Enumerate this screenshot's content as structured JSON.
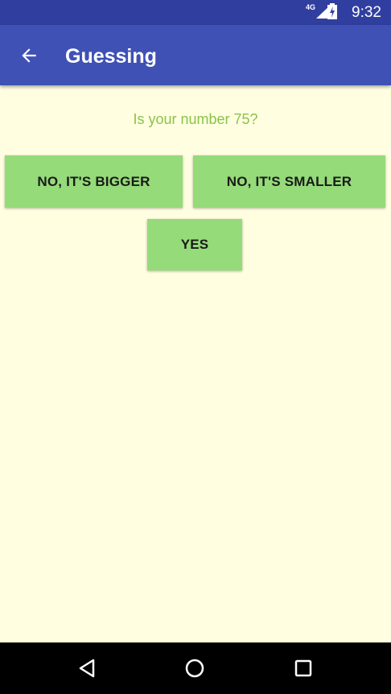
{
  "status_bar": {
    "network": "4G",
    "time": "9:32",
    "icons": [
      "signal-icon",
      "battery-charging-icon"
    ]
  },
  "app_bar": {
    "title": "Guessing",
    "back_icon": "arrow-back-icon"
  },
  "main": {
    "question": "Is your number 75?",
    "buttons": {
      "bigger": "NO, IT'S BIGGER",
      "smaller": "NO, IT'S SMALLER",
      "yes": "YES"
    }
  },
  "nav_bar": {
    "icons": [
      "nav-back-icon",
      "nav-home-icon",
      "nav-recents-icon"
    ]
  },
  "colors": {
    "status_bar": "#303F9F",
    "app_bar": "#3F51B5",
    "background": "#FFFEE0",
    "question_text": "#8BC34A",
    "button": "#95DB79"
  }
}
